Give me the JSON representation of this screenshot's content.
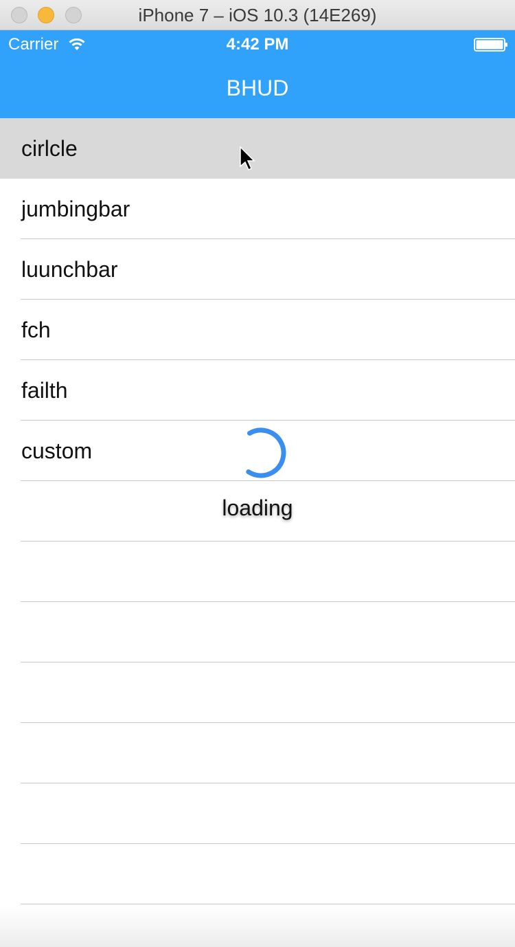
{
  "window": {
    "title": "iPhone 7 – iOS 10.3 (14E269)"
  },
  "status_bar": {
    "carrier": "Carrier",
    "time": "4:42 PM"
  },
  "nav_bar": {
    "title": "BHUD",
    "color": "#31a2fb"
  },
  "table": {
    "rows": [
      {
        "label": "cirlcle",
        "selected": true
      },
      {
        "label": "jumbingbar"
      },
      {
        "label": "luunchbar"
      },
      {
        "label": "fch"
      },
      {
        "label": "failth"
      },
      {
        "label": "custom"
      },
      {
        "label": ""
      },
      {
        "label": ""
      },
      {
        "label": ""
      },
      {
        "label": ""
      },
      {
        "label": ""
      },
      {
        "label": ""
      },
      {
        "label": ""
      }
    ]
  },
  "hud": {
    "text": "loading",
    "spinner_color": "#3a8ef0"
  },
  "icons": [
    "close-icon",
    "minimize-icon",
    "zoom-icon",
    "wifi-icon",
    "battery-icon",
    "spinner-icon",
    "cursor-icon"
  ]
}
